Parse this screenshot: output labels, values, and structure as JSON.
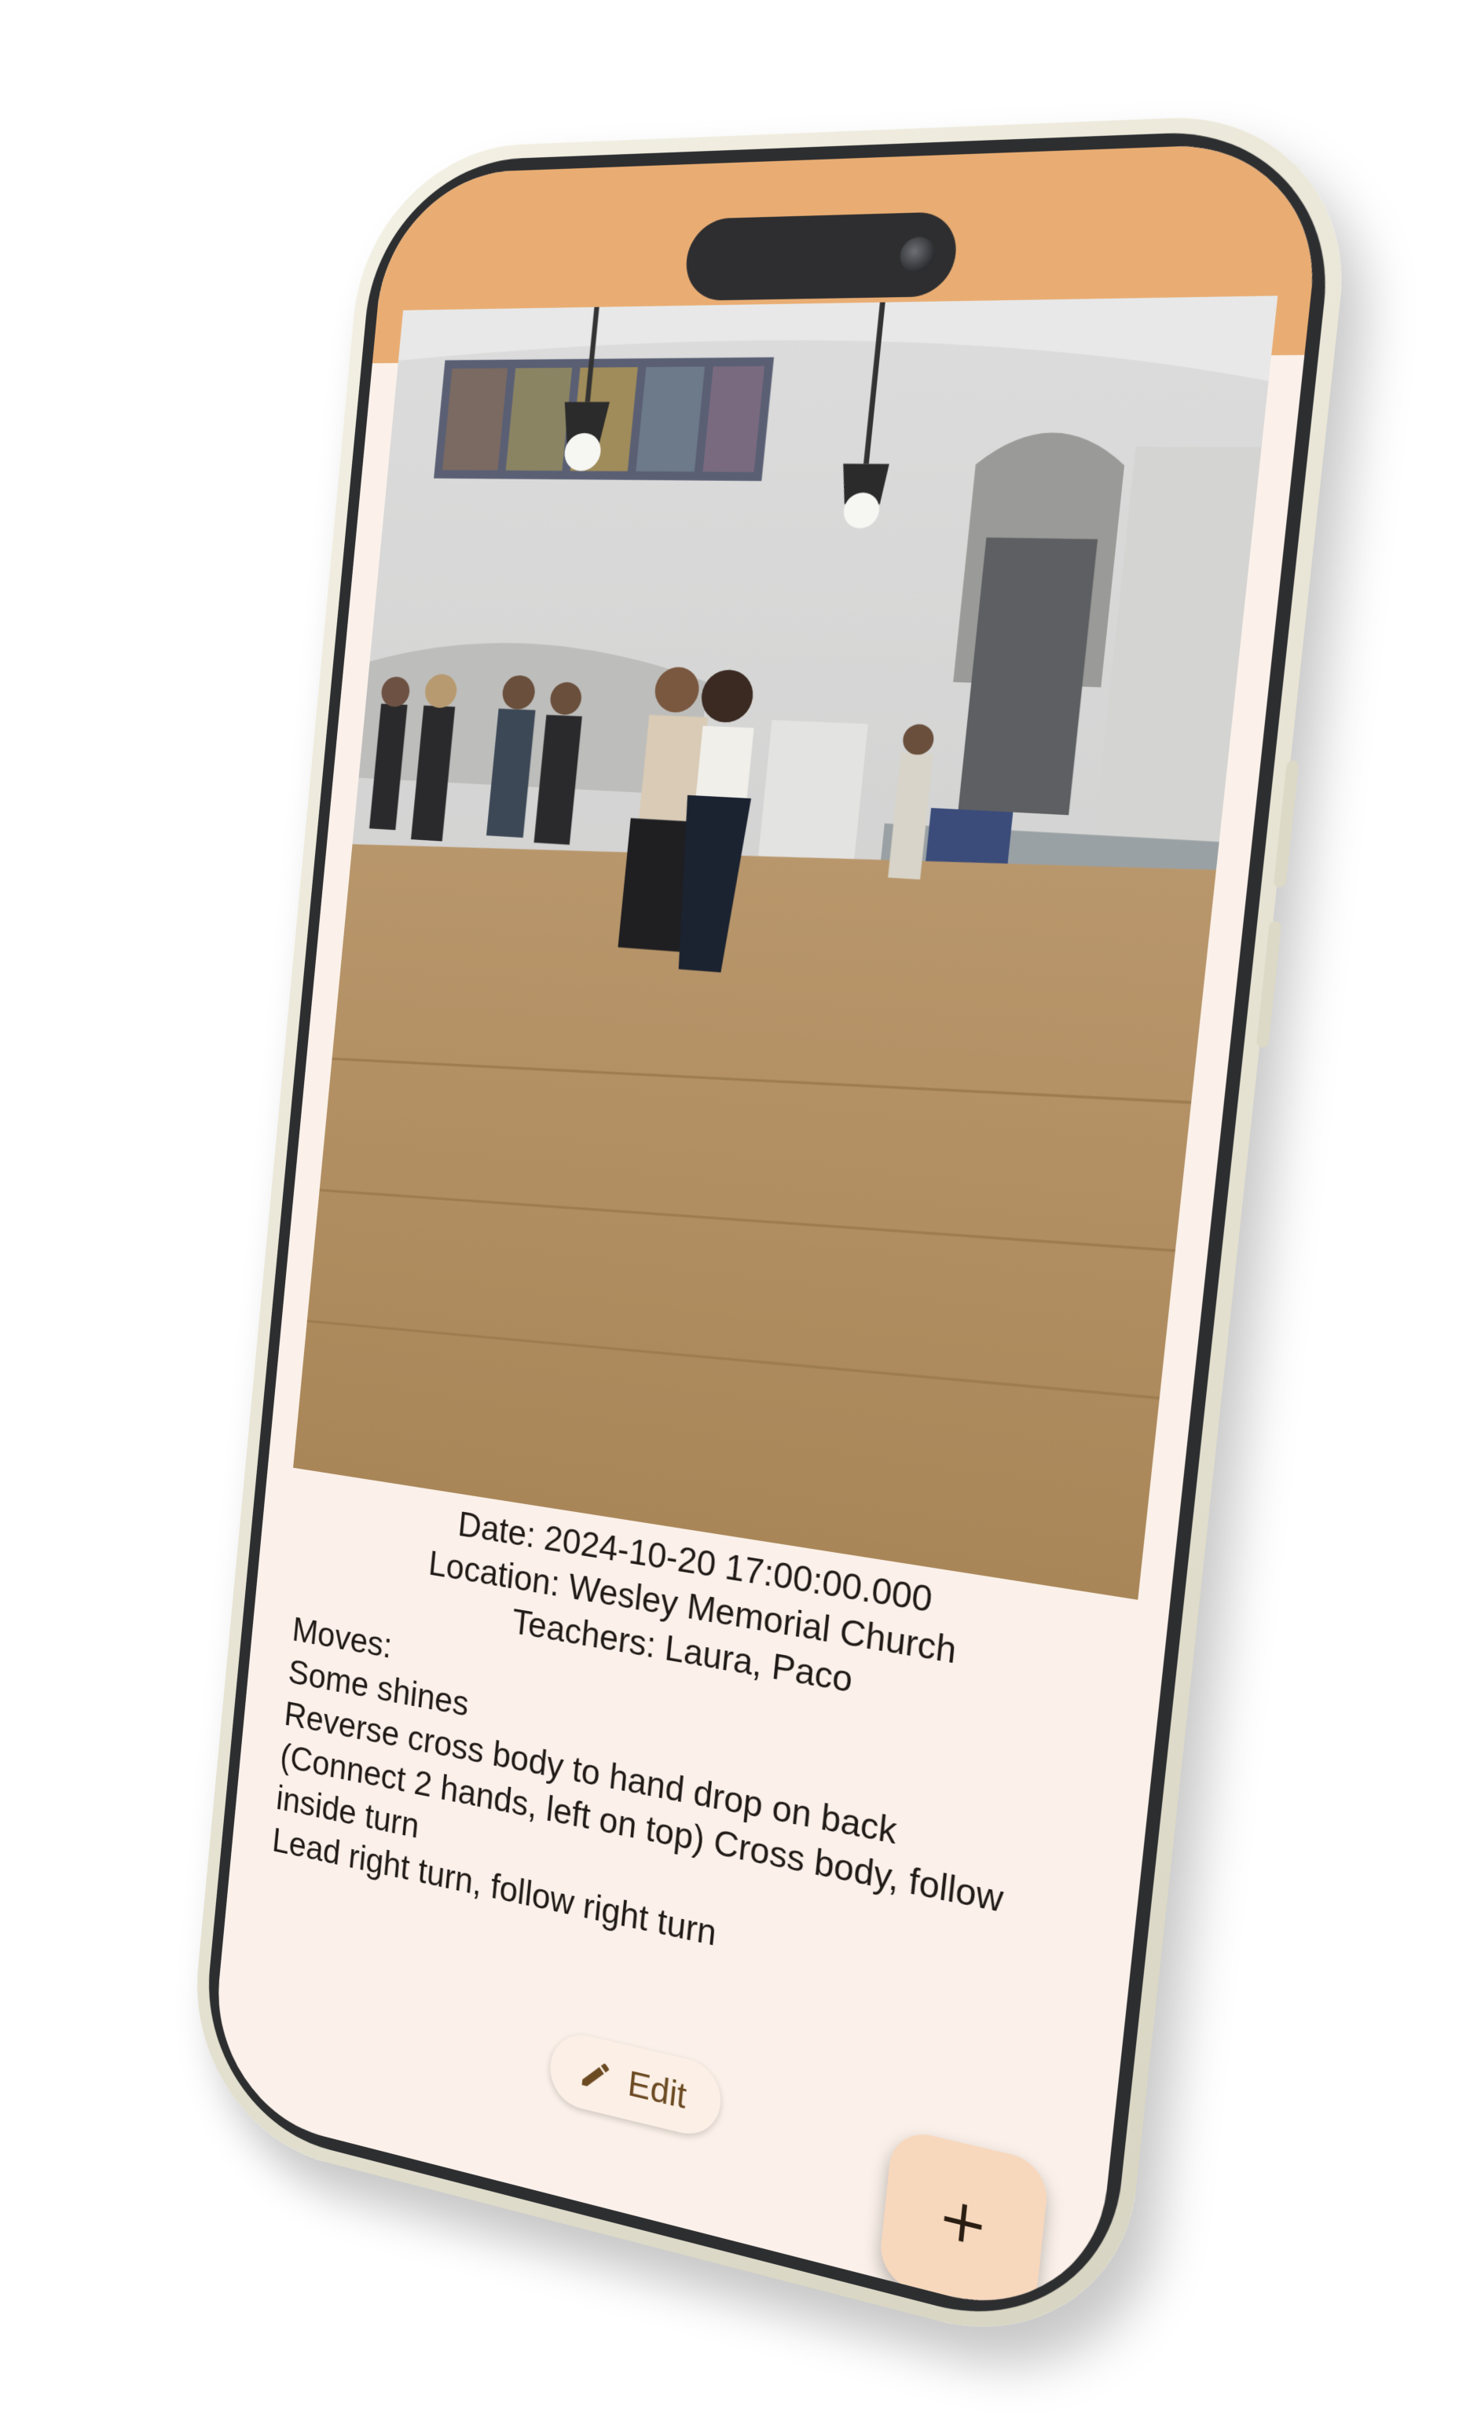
{
  "video": {
    "thumbnail_icon": "video-thumbnail"
  },
  "details": {
    "date": "Date: 2024-10-20 17:00:00.000",
    "location": "Location: Wesley Memorial Church",
    "teachers": "Teachers: Laura, Paco",
    "moves_label": "Moves:",
    "moves": [
      "Some shines",
      "Reverse cross body to hand drop on back",
      "(Connect 2 hands, left on top) Cross body, follow inside turn",
      "Lead right turn, follow right turn"
    ]
  },
  "actions": {
    "edit_label": "Edit",
    "edit_icon": "pencil-icon",
    "add_icon": "plus-icon"
  },
  "colors": {
    "status_bar": "#e9ad73",
    "surface": "#fbf1ea",
    "fab": "#f7d8bd",
    "edit_text": "#6b4a22"
  }
}
